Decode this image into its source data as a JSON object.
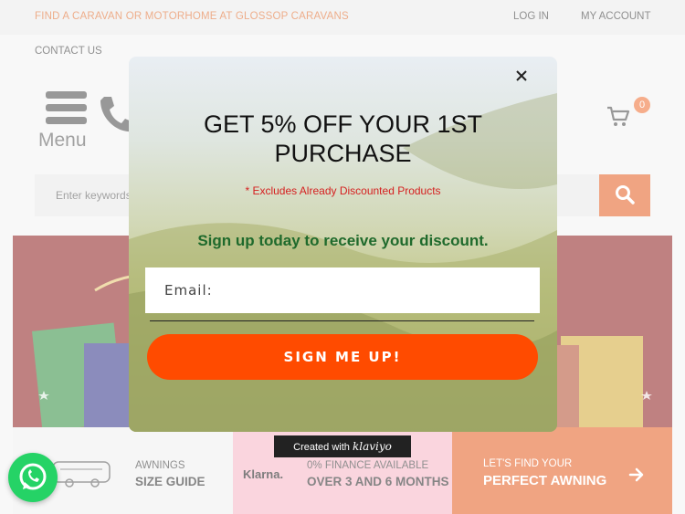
{
  "topbar": {
    "promo": "FIND A CARAVAN OR MOTORHOME AT GLOSSOP CARAVANS",
    "login": "LOG IN",
    "account": "MY ACCOUNT"
  },
  "nav": {
    "contact": "CONTACT US"
  },
  "header": {
    "menu_label": "Menu",
    "cart_count": "0"
  },
  "search": {
    "placeholder": "Enter keywords"
  },
  "strip": {
    "awnings_small": "AWNINGS",
    "awnings_big": "SIZE GUIDE",
    "klarna": "Klarna.",
    "finance_small": "0% FINANCE AVAILABLE",
    "finance_big": "OVER 3 AND 6 MONTHS",
    "find_small": "LET'S FIND YOUR",
    "find_big": "PERFECT AWNING"
  },
  "modal": {
    "title_line1": "GET 5% OFF YOUR 1ST",
    "title_line2": "PURCHASE",
    "note": "* Excludes Already Discounted Products",
    "subtitle": "Sign up today to receive your discount.",
    "email_placeholder": "Email:",
    "button": "SIGN ME UP!"
  },
  "klaviyo": {
    "prefix": "Created with",
    "brand": "klaviyo"
  },
  "colors": {
    "accent": "#e45a1c",
    "signup": "#ff4b00",
    "subtitle_green": "#1f6a2c",
    "note_red": "#d52020",
    "whatsapp": "#25d366"
  },
  "icons": [
    "menu-icon",
    "phone-icon",
    "cart-icon",
    "search-icon",
    "close-icon",
    "caravan-icon",
    "arrow-right-icon",
    "whatsapp-icon"
  ]
}
